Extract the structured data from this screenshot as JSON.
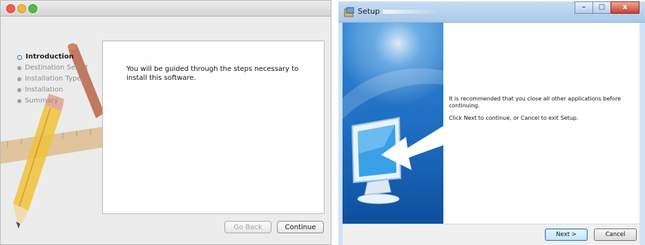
{
  "mac_installer": {
    "steps": [
      {
        "label": "Introduction",
        "active": true
      },
      {
        "label": "Destination Select",
        "active": false
      },
      {
        "label": "Installation Type",
        "active": false
      },
      {
        "label": "Installation",
        "active": false
      },
      {
        "label": "Summary",
        "active": false
      }
    ],
    "message": "You will be guided through the steps necessary to install this software.",
    "back_label": "Go Back",
    "continue_label": "Continue",
    "icons": [
      "pencil-ruler-brush-artwork"
    ]
  },
  "win_setup": {
    "title": "Setup -",
    "message1": "It is recommended that you close all other applications before continuing.",
    "message2": "Click Next to continue, or Cancel to exit Setup.",
    "next_label": "Next >",
    "cancel_label": "Cancel",
    "controls": {
      "minimize": "–",
      "maximize": "□",
      "close": "x"
    },
    "colors": {
      "accent": "#2f7fd6",
      "panel": "#2b86d8"
    }
  }
}
